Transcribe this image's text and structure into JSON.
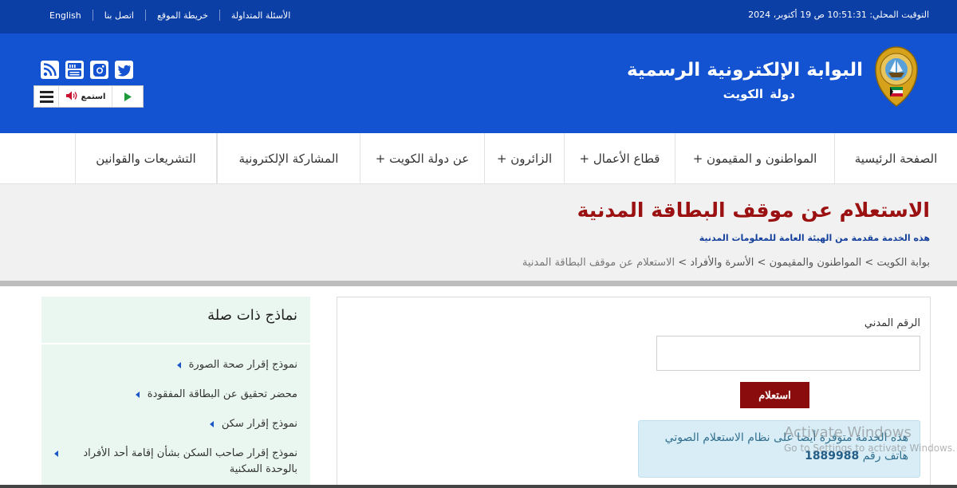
{
  "topbar": {
    "clock": "التوقيت المحلي: 10:51:31 ص 19 أكتوبر، 2024",
    "links": [
      "الأسئلة المتداولة",
      "خريطة الموقع",
      "اتصل بنا",
      "English"
    ]
  },
  "header": {
    "title": "البوابة الإلكترونية الرسمية",
    "subtitle": "دولة الكويت",
    "player": {
      "listen_label": "استمع"
    }
  },
  "nav": {
    "items": [
      "الصفحة الرئيسية",
      "المواطنون و المقيمون +",
      "قطاع الأعمال +",
      "الزائرون +",
      "عن دولة الكويت +",
      "المشاركة الإلكترونية",
      "التشريعات والقوانين"
    ]
  },
  "page": {
    "title": "الاستعلام عن موقف البطاقة المدنية",
    "provider": "هذه الخدمة مقدمة من الهيئة العامة للمعلومات المدنية",
    "breadcrumb": [
      "بوابة الكويت",
      "المواطنون والمقيمون",
      "الأسرة والأفراد",
      "الاستعلام عن موقف البطاقة المدنية"
    ]
  },
  "form": {
    "civil_id_label": "الرقم المدني",
    "civil_id_value": "",
    "submit_label": "استعلام",
    "info_text": "هذه الخدمة متوفرة أيضا على نظام الاستعلام الصوتي هاتف رقم",
    "info_phone": "1889988"
  },
  "sidebar": {
    "title": "نماذج ذات صلة",
    "items": [
      "نموذج إقرار صحة الصورة",
      "محضر تحقيق عن البطاقة المفقودة",
      "نموذج إقرار سكن",
      "نموذج إقرار صاحب السكن بشأن إقامة أحد الأفراد بالوحدة السكنية"
    ]
  },
  "watermark": {
    "line1": "Activate Windows",
    "line2": "Go to Settings to activate Windows."
  },
  "colors": {
    "topbar": "#0c3fa6",
    "header": "#1352d1",
    "title_red": "#9b1010",
    "button": "#8a0c0c",
    "info_bg": "#d9edf7",
    "sidebar_bg": "#e9f7f0"
  },
  "icons": [
    "kuwait-emblem-icon",
    "rss-icon",
    "youtube-icon",
    "instagram-icon",
    "twitter-icon",
    "menu-icon",
    "speaker-icon",
    "play-icon"
  ]
}
